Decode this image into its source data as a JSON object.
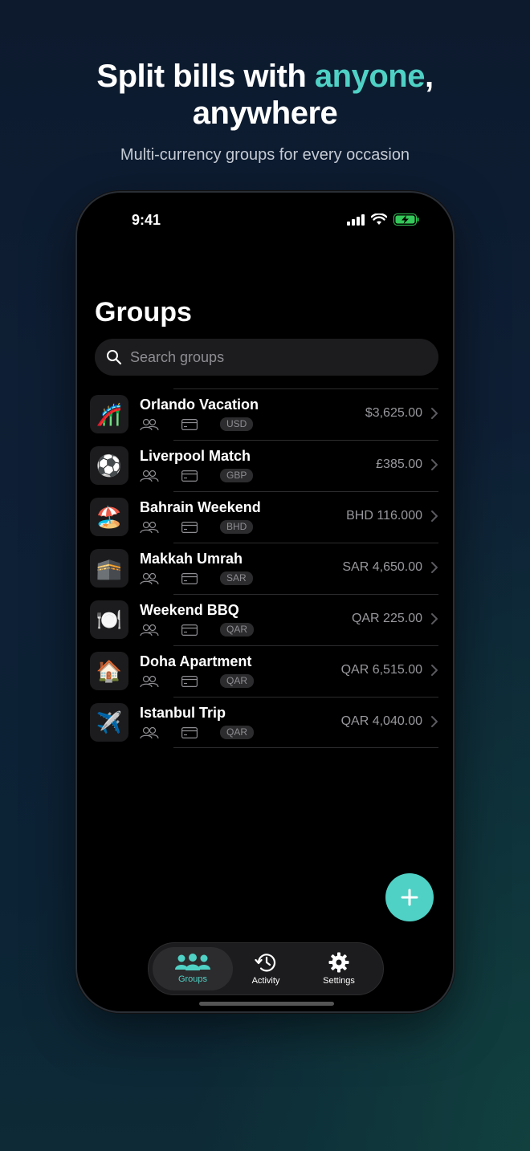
{
  "promo": {
    "headline_part1": "Split bills with ",
    "headline_accent": "anyone",
    "headline_part2": ",",
    "headline_line2": "anywhere",
    "subheadline": "Multi-currency groups for every occasion"
  },
  "status_bar": {
    "time": "9:41"
  },
  "screen": {
    "title": "Groups",
    "search": {
      "placeholder": "Search groups"
    }
  },
  "groups": [
    {
      "icon": "🎢",
      "name": "Orlando Vacation",
      "currency": "USD",
      "amount": "$3,625.00"
    },
    {
      "icon": "⚽",
      "name": "Liverpool Match",
      "currency": "GBP",
      "amount": "£385.00"
    },
    {
      "icon": "🏖️",
      "name": "Bahrain Weekend",
      "currency": "BHD",
      "amount": "BHD 116.000"
    },
    {
      "icon": "🕋",
      "name": "Makkah Umrah",
      "currency": "SAR",
      "amount": "SAR 4,650.00"
    },
    {
      "icon": "🍽️",
      "name": "Weekend BBQ",
      "currency": "QAR",
      "amount": "QAR 225.00"
    },
    {
      "icon": "🏠",
      "name": "Doha Apartment",
      "currency": "QAR",
      "amount": "QAR 6,515.00"
    },
    {
      "icon": "✈️",
      "name": "Istanbul Trip",
      "currency": "QAR",
      "amount": "QAR 4,040.00"
    }
  ],
  "tabbar": {
    "groups_label": "Groups",
    "activity_label": "Activity",
    "settings_label": "Settings"
  },
  "colors": {
    "accent": "#4fd1c5",
    "background": "#000000",
    "secondary_text": "#8e8e93"
  }
}
